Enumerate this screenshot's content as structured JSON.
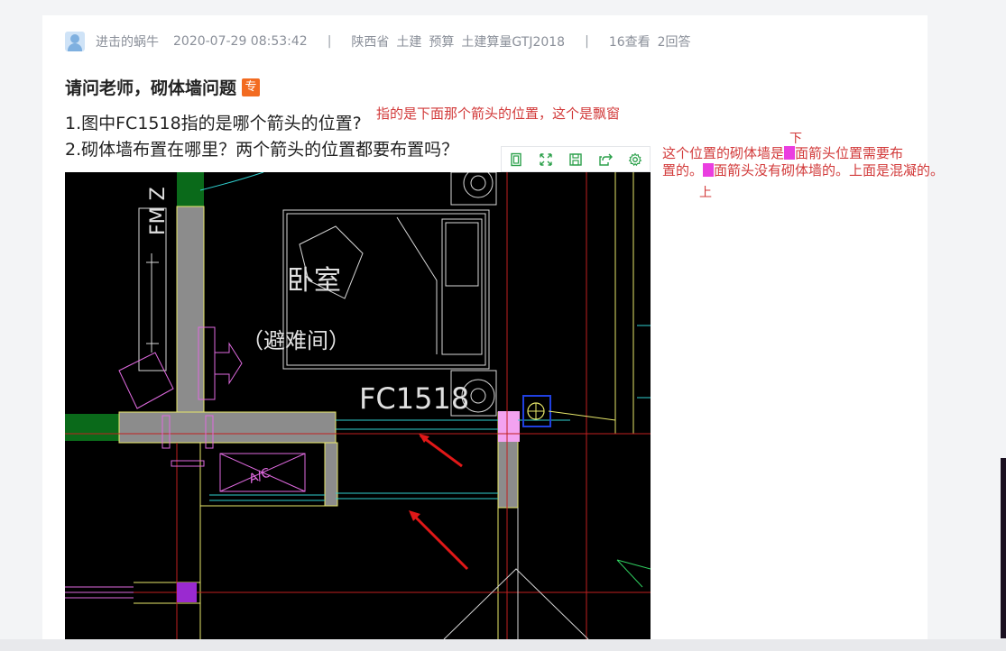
{
  "meta": {
    "author": "进击的蜗牛",
    "datetime": "2020-07-29 08:53:42",
    "separator": "|",
    "province": "陕西省",
    "cat1": "土建",
    "cat2": "预算",
    "cat3": "土建算量GTJ2018",
    "views": "16查看",
    "answers": "2回答"
  },
  "question": {
    "title": "请问老师，砌体墙问题",
    "tag": "专",
    "line1": "1.图中FC1518指的是哪个箭头的位置?",
    "line2": "2.砌体墙布置在哪里？两个箭头的位置都要布置吗？"
  },
  "annotations": {
    "note1": "指的是下面那个箭头的位置，这个是飘窗",
    "small_top": "下",
    "n2a": "这个位置的砌体墙是",
    "n2b": "面箭头位置需要布",
    "n2c": "置的。",
    "n2d": "面箭头没有砌体墙的。上面是混凝的。",
    "small_bottom": "上"
  },
  "toolbar": {
    "icons": [
      "fit-icon",
      "fullscreen-icon",
      "save-icon",
      "share-icon",
      "settings-icon"
    ]
  },
  "drawing": {
    "room_label": "卧室",
    "room_sub": "（避难间）",
    "window_label": "FC1518",
    "fm_label": "FM Z",
    "ac_label": "A/C"
  },
  "colors": {
    "annotation_red": "#d23a3a",
    "tag_orange": "#f26b21",
    "toolbar_green": "#2ba04a",
    "highlight_magenta": "#ea3ee0"
  }
}
